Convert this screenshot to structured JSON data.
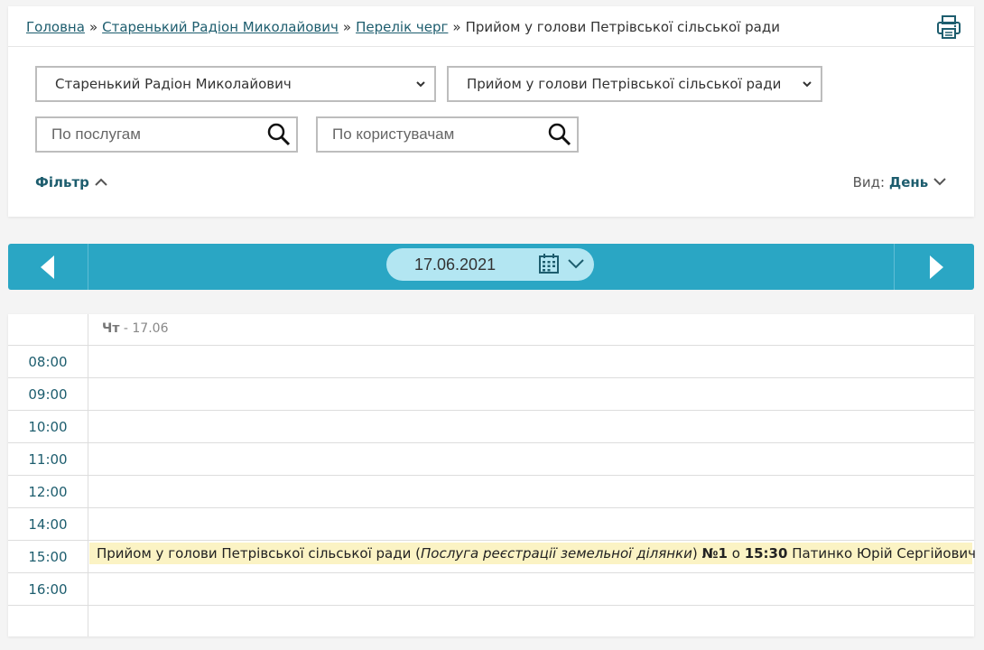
{
  "breadcrumb": {
    "items": [
      {
        "label": "Головна",
        "link": true
      },
      {
        "label": "Старенький Радіон Миколайович",
        "link": true
      },
      {
        "label": "Перелік черг",
        "link": true
      },
      {
        "label": "Прийом у голови Петрівської сільської ради",
        "link": false
      }
    ],
    "separator": "»"
  },
  "filters": {
    "person_select": "Старенький Радіон Миколайович",
    "queue_select": "Прийом у голови Петрівської сільської ради",
    "services_search_placeholder": "По послугам",
    "users_search_placeholder": "По користувачам",
    "filter_label": "Фільтр",
    "view_label": "Вид:",
    "view_value": "День"
  },
  "date_nav": {
    "current_date": "17.06.2021"
  },
  "schedule": {
    "day_abbr": "Чт",
    "day_date": "- 17.06",
    "rows": [
      {
        "time": "08:00"
      },
      {
        "time": "09:00"
      },
      {
        "time": "10:00"
      },
      {
        "time": "11:00"
      },
      {
        "time": "12:00"
      },
      {
        "time": "14:00"
      },
      {
        "time": "15:00"
      },
      {
        "time": "16:00"
      },
      {
        "time": ""
      }
    ],
    "event": {
      "queue": "Прийом у голови Петрівської сільської ради",
      "paren_open": " (",
      "service": "Послуга реєстрації земельної ділянки",
      "paren_close": ") ",
      "number": "№1",
      "at": " о ",
      "time": "15:30",
      "person": " Патинко Юрій Сергійович"
    }
  },
  "colors": {
    "accent": "#2aa6c4",
    "link": "#1d5d6e",
    "event_bg": "#fbf3c4",
    "date_pill": "#b3e6f2"
  }
}
